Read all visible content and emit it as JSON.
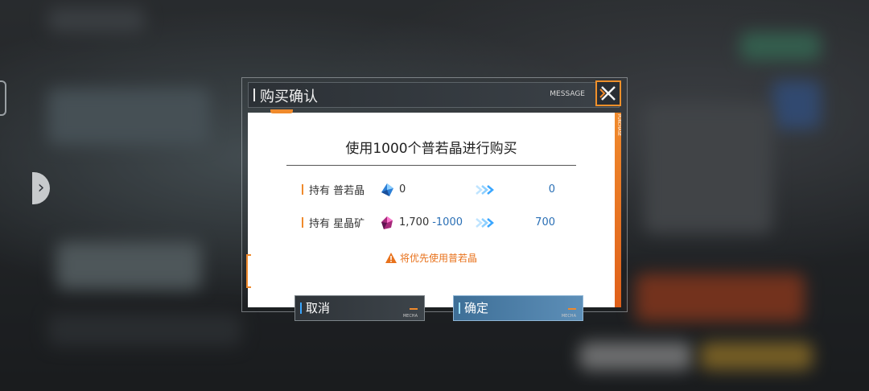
{
  "dialog": {
    "title": "购买确认",
    "tag": "MESSAGE",
    "rail_label": "PURCHASE",
    "heading": "使用1000个普若晶进行购买",
    "rows": [
      {
        "label": "持有 普若晶",
        "icon": "blue-crystal-icon",
        "current": "0",
        "delta": "",
        "result": "0"
      },
      {
        "label": "持有 星晶矿",
        "icon": "pink-crystal-icon",
        "current": "1,700",
        "delta": "-1000",
        "result": "700"
      }
    ],
    "warning": "将优先使用普若晶",
    "cancel_label": "取消",
    "confirm_label": "确定",
    "button_tag": "MECHA"
  },
  "colors": {
    "accent_orange": "#f08a2c",
    "value_blue": "#2a6fb5",
    "confirm_blue": "#5d8fb8"
  }
}
